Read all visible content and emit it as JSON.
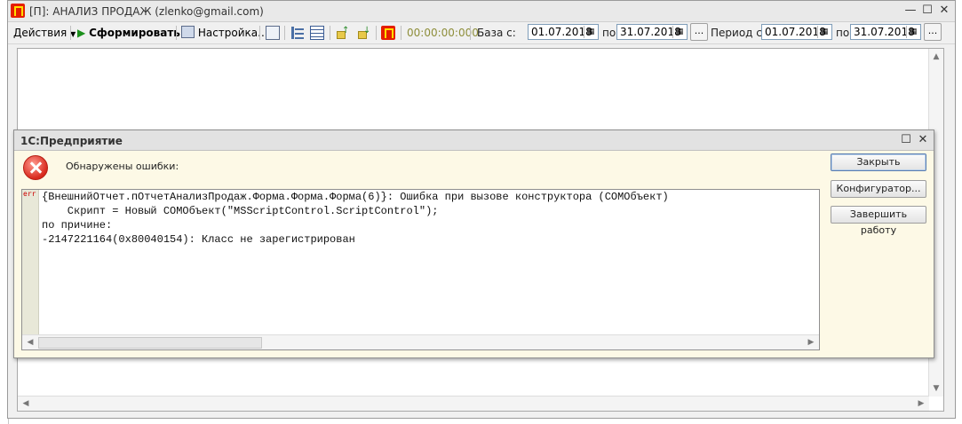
{
  "main_window": {
    "title": "[П]: АНАЛИЗ ПРОДАЖ (zlenko@gmail.com)",
    "controls": {
      "minimize": "—",
      "maximize": "☐",
      "close": "✕"
    }
  },
  "toolbar": {
    "actions_label": "Действия",
    "generate_label": "Сформировать",
    "settings_label": "Настройка...",
    "timer": "00:00:00:000",
    "base_from_label": "База с:",
    "base_from_value": "01.07.2018",
    "base_to_label": "по",
    "base_to_value": "31.07.2018",
    "dots": "...",
    "period_from_label": "Период с:",
    "period_from_value": "01.07.2018",
    "period_to_label": "по",
    "period_to_value": "31.07.2018"
  },
  "dialog": {
    "title": "1С:Предприятие",
    "heading": "Обнаружены ошибки:",
    "error_marker": "err",
    "error_lines": [
      "{ВнешнийОтчет.пОтчетАнализПродаж.Форма.Форма.Форма(6)}: Ошибка при вызове конструктора (COMОбъект)",
      "    Скрипт = Новый COMОбъект(\"MSScriptControl.ScriptControl\");",
      "по причине:",
      "-2147221164(0x80040154): Класс не зарегистрирован"
    ],
    "buttons": {
      "close": "Закрыть",
      "configurator": "Конфигуратор...",
      "shutdown": "Завершить работу"
    }
  },
  "colors": {
    "error_red": "#d8291d",
    "dialog_bg": "#fdf9e6",
    "brand_red": "#e51e00",
    "brand_yellow": "#ffde00"
  }
}
